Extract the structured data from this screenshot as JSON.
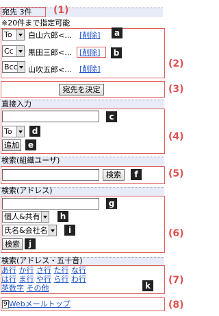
{
  "recipients": {
    "header": "宛先 3件",
    "note": "※20件まで指定可能",
    "rows": [
      {
        "type": "To",
        "name": "白山六郎<…",
        "delete": "[削除]"
      },
      {
        "type": "Cc",
        "name": "黒田三郎<…",
        "delete": "[削除]"
      },
      {
        "type": "Bcc",
        "name": "山吹五郎<…",
        "delete": "[削除]"
      }
    ]
  },
  "confirm_button": "宛先を決定",
  "direct": {
    "header": "直接入力",
    "input_value": "",
    "type_select": "To",
    "add_button": "追加"
  },
  "org_search": {
    "header": "検索(組織ユーザ)",
    "input_value": "",
    "search_button": "検索"
  },
  "address_search": {
    "header": "検索(アドレス)",
    "input_value": "",
    "scope_select": "個人&共有",
    "field_select": "氏名&会社名",
    "search_button": "検索"
  },
  "kana_search": {
    "header": "検索(アドレス・五十音)",
    "row1": [
      "あ行",
      "か行",
      "さ行",
      "た行",
      "な行"
    ],
    "row2": [
      "は行",
      "ま行",
      "や行",
      "ら行",
      "わ行"
    ],
    "row3": [
      "英数字",
      "その他"
    ]
  },
  "footer": {
    "key": "9",
    "link": "Webメールトップ"
  },
  "annotations": {
    "numbers": [
      "(1)",
      "(2)",
      "(3)",
      "(4)",
      "(5)",
      "(6)",
      "(7)",
      "(8)"
    ],
    "letters": [
      "a",
      "b",
      "c",
      "d",
      "e",
      "f",
      "g",
      "h",
      "i",
      "j",
      "k"
    ]
  },
  "colors": {
    "annotation_red": "#e05050",
    "link_blue": "#2255cc",
    "header_bg": "#e8ecf8"
  }
}
